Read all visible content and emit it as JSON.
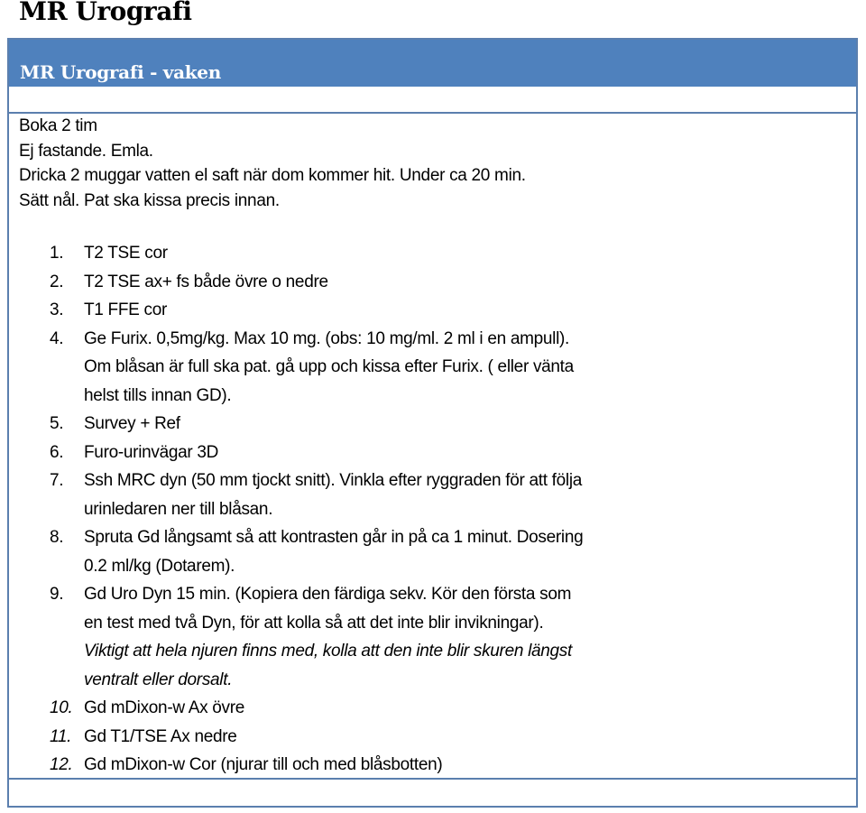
{
  "document": {
    "title": "MR Urografi",
    "table": {
      "header_title": "MR Urografi - vaken",
      "accent_color": "#4f81bd",
      "border_color": "#5b7fae",
      "intro_lines": [
        "Boka 2 tim",
        "Ej fastande. Emla.",
        "Dricka 2 muggar vatten el saft när dom kommer hit. Under ca 20 min.",
        "Sätt nål. Pat ska kissa precis innan."
      ],
      "steps": [
        {
          "number": "1.",
          "lines": [
            "T2 TSE cor"
          ]
        },
        {
          "number": "2.",
          "lines": [
            "T2 TSE ax+ fs både övre o nedre"
          ]
        },
        {
          "number": "3.",
          "lines": [
            "T1 FFE cor"
          ]
        },
        {
          "number": "4.",
          "lines": [
            "Ge Furix. 0,5mg/kg. Max 10 mg.  (obs: 10 mg/ml. 2 ml i en ampull).",
            "Om blåsan är full ska pat.  gå upp och kissa efter Furix. ( eller vänta",
            "helst tills innan GD)."
          ]
        },
        {
          "number": "5.",
          "lines": [
            "Survey + Ref"
          ]
        },
        {
          "number": "6.",
          "lines": [
            "Furo-urinvägar 3D"
          ]
        },
        {
          "number": "7.",
          "lines": [
            "Ssh MRC dyn (50 mm tjockt snitt). Vinkla efter ryggraden för att följa",
            "urinledaren ner till blåsan."
          ]
        },
        {
          "number": "8.",
          "lines": [
            "Spruta Gd långsamt så att kontrasten går in på ca 1 minut. Dosering",
            "0.2 ml/kg (Dotarem)."
          ]
        },
        {
          "number": "9.",
          "lines": [
            "Gd Uro Dyn 15 min.  (Kopiera den färdiga sekv. Kör den första som",
            "en test med två Dyn, för att kolla så att det inte blir invikningar)."
          ],
          "italic_lines": [
            "Viktigt att hela njuren finns med, kolla att den inte blir skuren längst",
            "ventralt eller dorsalt."
          ]
        },
        {
          "number": "10.",
          "lines": [
            "Gd mDixon-w Ax övre"
          ]
        },
        {
          "number": "11.",
          "lines": [
            "Gd T1/TSE  Ax nedre"
          ]
        },
        {
          "number": "12.",
          "lines": [
            "Gd mDixon-w  Cor (njurar till och med blåsbotten)"
          ]
        }
      ]
    }
  }
}
